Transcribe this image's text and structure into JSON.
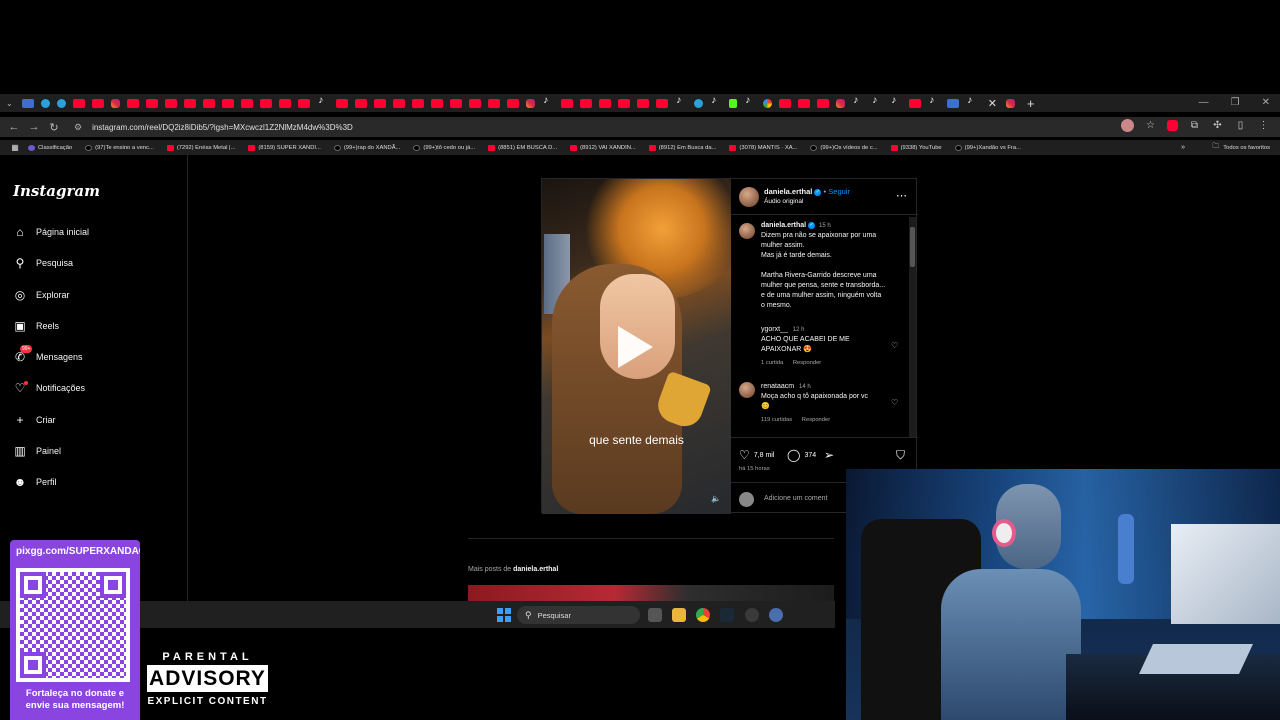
{
  "browser": {
    "url": "instagram.com/reel/DQ2iz8iDib5/?igsh=MXcwczl1Z2NlMzM4dw%3D%3D",
    "bookmarks": [
      "Classificação",
      "(97)Te ensino a venc...",
      "(7292) Enéas Metal |...",
      "(8159) SUPER XANDI...",
      "(99+)rap do XANDÃ...",
      "(99+)tô cedo ou já...",
      "(8851) EM BUSCA D...",
      "(8912) VAI XANDIN...",
      "(8912) Em Busca da...",
      "(3078) MANTIS · XA...",
      "(99+)Os vídeos de c...",
      "(9338) YouTube",
      "(99+)Xandão vs Fra..."
    ],
    "all_favorites": "Todos os favoritos"
  },
  "instagram": {
    "logo": "Instagram",
    "nav": [
      {
        "label": "Página inicial",
        "icon": "home-icon"
      },
      {
        "label": "Pesquisa",
        "icon": "search-icon"
      },
      {
        "label": "Explorar",
        "icon": "compass-icon"
      },
      {
        "label": "Reels",
        "icon": "reels-icon"
      },
      {
        "label": "Mensagens",
        "icon": "messenger-icon",
        "badge": "99+"
      },
      {
        "label": "Notificações",
        "icon": "heart-icon"
      },
      {
        "label": "Criar",
        "icon": "plus-icon"
      },
      {
        "label": "Painel",
        "icon": "dashboard-icon"
      },
      {
        "label": "Perfil",
        "icon": "avatar-icon"
      }
    ],
    "post": {
      "username": "daniela.erthal",
      "follow": "Seguir",
      "audio": "Áudio original",
      "video_caption": "que sente demais",
      "caption_time": "15 h",
      "caption_lines": [
        "Dizem pra não se apaixonar por uma",
        "mulher assim.",
        "Mas já é tarde demais.",
        "",
        "Martha Rivera-Garrido descreve uma",
        "mulher que pensa, sente e transborda...",
        "e de uma mulher assim, ninguém volta",
        "o mesmo."
      ],
      "comments": [
        {
          "user": "ygorxt__",
          "time": "12 h",
          "text": [
            "ACHO QUE ACABEI DE ME",
            "APAIXONAR 😍"
          ],
          "likes": "1 curtida",
          "reply": "Responder"
        },
        {
          "user": "renataacm",
          "time": "14 h",
          "text": [
            "Moça acho q tô apaixonada por vc",
            "😊"
          ],
          "likes": "119 curtidas",
          "reply": "Responder"
        }
      ],
      "like_count": "7,8 mil",
      "comment_count": "374",
      "posted": "há 15 horas",
      "add_comment_placeholder": "Adicione um coment"
    },
    "more_posts_prefix": "Mais posts de",
    "more_posts_user": "daniela.erthal"
  },
  "taskbar": {
    "search_placeholder": "Pesquisar"
  },
  "overlay": {
    "qr_url": "pixgg.com/SUPERXANDAO",
    "qr_message": [
      "Fortaleça no donate e",
      "envie sua mensagem!"
    ],
    "advisory": [
      "PARENTAL",
      "ADVISORY",
      "EXPLICIT CONTENT"
    ]
  }
}
